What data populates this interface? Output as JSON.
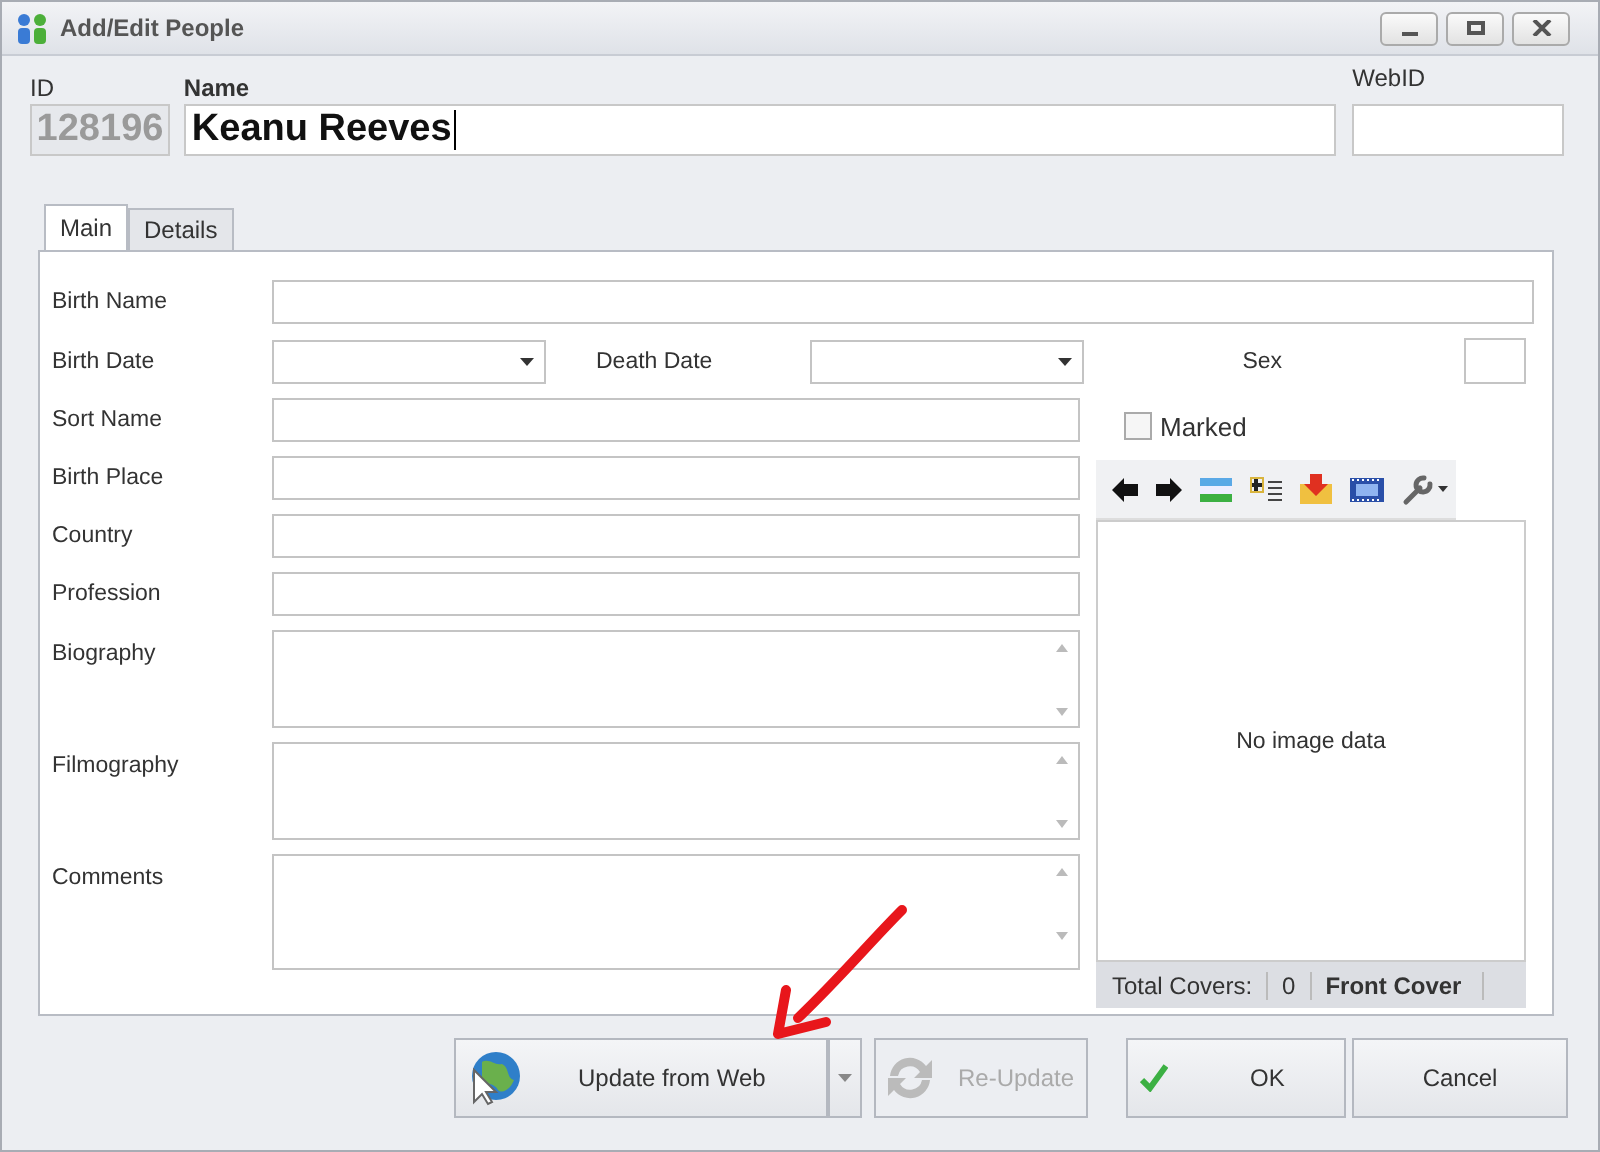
{
  "window": {
    "title": "Add/Edit People"
  },
  "header": {
    "id_label": "ID",
    "id_value": "128196",
    "name_label": "Name",
    "name_value": "Keanu Reeves",
    "webid_label": "WebID"
  },
  "tabs": [
    {
      "label": "Main",
      "selected": true
    },
    {
      "label": "Details",
      "selected": false
    }
  ],
  "birth_name": {
    "label": "Birth Name"
  },
  "birth_date": {
    "label": "Birth Date"
  },
  "death_date": {
    "label": "Death Date"
  },
  "sex": {
    "label": "Sex"
  },
  "fields": [
    {
      "label": "Sort Name",
      "kind": "text"
    },
    {
      "label": "Birth Place",
      "kind": "text"
    },
    {
      "label": "Country",
      "kind": "text"
    },
    {
      "label": "Profession",
      "kind": "text"
    },
    {
      "label": "Biography",
      "kind": "memo"
    },
    {
      "label": "Filmography",
      "kind": "memo"
    },
    {
      "label": "Comments",
      "kind": "memo"
    }
  ],
  "marked": {
    "label": "Marked",
    "checked": false
  },
  "image_panel": {
    "message": "No image data",
    "total_label": "Total Covers:",
    "total_count": "0",
    "cover": "Front Cover"
  },
  "buttons": {
    "update": {
      "label": "Update from Web"
    },
    "reupdate": {
      "label": "Re-Update",
      "disabled": true
    },
    "ok": {
      "label": "OK"
    },
    "cancel": {
      "label": "Cancel"
    }
  }
}
